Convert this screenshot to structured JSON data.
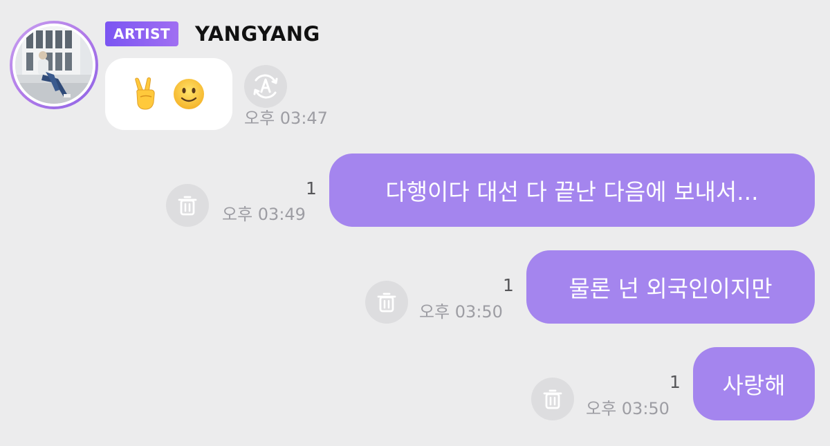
{
  "sender": {
    "badge": "ARTIST",
    "name": "YANGYANG"
  },
  "incoming": {
    "emoji_1": "✌️",
    "emoji_2": "🙂",
    "time": "오후 03:47"
  },
  "outgoing": [
    {
      "text": "다행이다 대선 다 끝난 다음에 보내서...",
      "read_count": "1",
      "time": "오후 03:49"
    },
    {
      "text": "물론 넌 외국인이지만",
      "read_count": "1",
      "time": "오후 03:50"
    },
    {
      "text": "사랑해",
      "read_count": "1",
      "time": "오후 03:50"
    }
  ],
  "colors": {
    "background": "#ececed",
    "outgoing_bubble": "#a485ee",
    "incoming_bubble": "#ffffff",
    "badge_start": "#7b55f2",
    "badge_end": "#a06ff2",
    "timestamp": "#9d9da3"
  },
  "icons": {
    "translate": "translate-icon",
    "delete": "trash-icon"
  }
}
